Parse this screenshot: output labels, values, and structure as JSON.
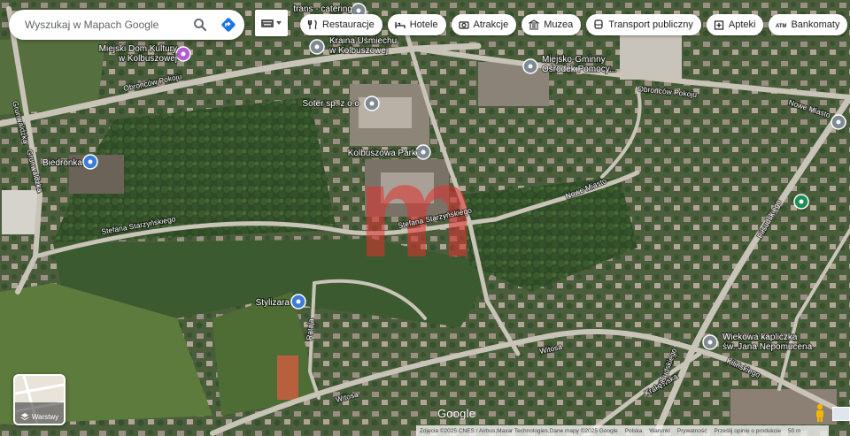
{
  "search": {
    "placeholder": "Wyszukaj w Mapach Google"
  },
  "chips": [
    {
      "label": "Restauracje",
      "icon": "fork-knife-icon"
    },
    {
      "label": "Hotele",
      "icon": "bed-icon"
    },
    {
      "label": "Atrakcje",
      "icon": "camera-icon"
    },
    {
      "label": "Muzea",
      "icon": "museum-icon"
    },
    {
      "label": "Transport publiczny",
      "icon": "bus-icon"
    },
    {
      "label": "Apteki",
      "icon": "pharmacy-icon"
    },
    {
      "label": "Bankomaty",
      "icon": "atm-icon"
    }
  ],
  "places": [
    {
      "name": "Miejski Dom Kultury\nw Kolbuszowej",
      "icon": "shopping-bag-icon",
      "color": "#b05fcf"
    },
    {
      "name": "Kraina Uśmiechu\nw Kolbuszowej",
      "icon": "pin-icon",
      "color": "#7f8a93"
    },
    {
      "name": "Soter sp. z o.o",
      "icon": "pin-icon",
      "color": "#7f8a93"
    },
    {
      "name": "Kolbuszowa Park",
      "icon": "pin-icon",
      "color": "#7f8a93"
    },
    {
      "name": "Miejsko-Gminny\nOśrodek Pomocy...",
      "icon": "pin-icon",
      "color": "#7f8a93"
    },
    {
      "name": "Biedronka",
      "icon": "grocery-icon",
      "color": "#3d7dd8"
    },
    {
      "name": "Stylizara",
      "icon": "beauty-icon",
      "color": "#3d7dd8"
    },
    {
      "name": "Wiekowa kapliczka\nśw. Jana Nepomucena",
      "icon": "chapel-icon",
      "color": "#7f8a93"
    },
    {
      "name": "",
      "icon": "park-icon",
      "color": "#1e8e5a"
    },
    {
      "name": "",
      "icon": "pin-icon",
      "color": "#7f8a93"
    },
    {
      "name": "trans - catering",
      "icon": "pin-icon",
      "color": "#7f8a93"
    }
  ],
  "roads": [
    "Obrońców Pokoju",
    "Grunwaldzka",
    "Stefana Starzyńskiego",
    "Nowe Miasto",
    "Piłsudskiego",
    "Witosa",
    "Krakowska",
    "Kilińskiego",
    "Rataja"
  ],
  "layers": {
    "label": "Warstwy"
  },
  "branding": {
    "logo": "Google",
    "watermark": "m"
  },
  "attribution": {
    "text": "Zdjęcia ©2025 CNES / Airbus,Maxar Technologies,Dane mapy ©2025 Google",
    "links": [
      "Polska",
      "Warunki",
      "Prywatność",
      "Prześlij opinię o produkcie"
    ],
    "scale": "50 m"
  }
}
